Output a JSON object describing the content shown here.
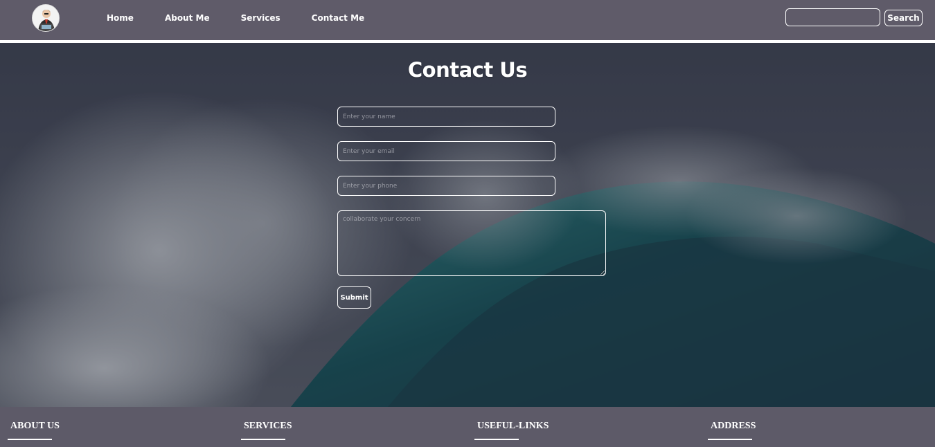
{
  "navbar": {
    "logo_alt": "profile avatar",
    "links": [
      {
        "label": "Home"
      },
      {
        "label": "About Me"
      },
      {
        "label": "Services"
      },
      {
        "label": "Contact Me"
      }
    ],
    "search": {
      "placeholder": "",
      "value": "",
      "button_label": "Search"
    }
  },
  "hero": {
    "title": "Contact Us",
    "form": {
      "name_placeholder": "Enter your name",
      "email_placeholder": "Enter your email",
      "phone_placeholder": "Enter your phone",
      "concern_placeholder": "collaborate your concern",
      "submit_label": "Submit"
    }
  },
  "footer": {
    "columns": [
      {
        "heading": "ABOUT US"
      },
      {
        "heading": "SERVICES"
      },
      {
        "heading": "USEFUL-LINKS"
      },
      {
        "heading": "ADDRESS"
      }
    ]
  },
  "colors": {
    "navbar_bg": "#5f5b69",
    "footer_bg": "#5d5a68",
    "text": "#ffffff",
    "border": "#ffffff"
  },
  "icons": [
    "avatar-icon",
    "ocean-wave-background"
  ]
}
